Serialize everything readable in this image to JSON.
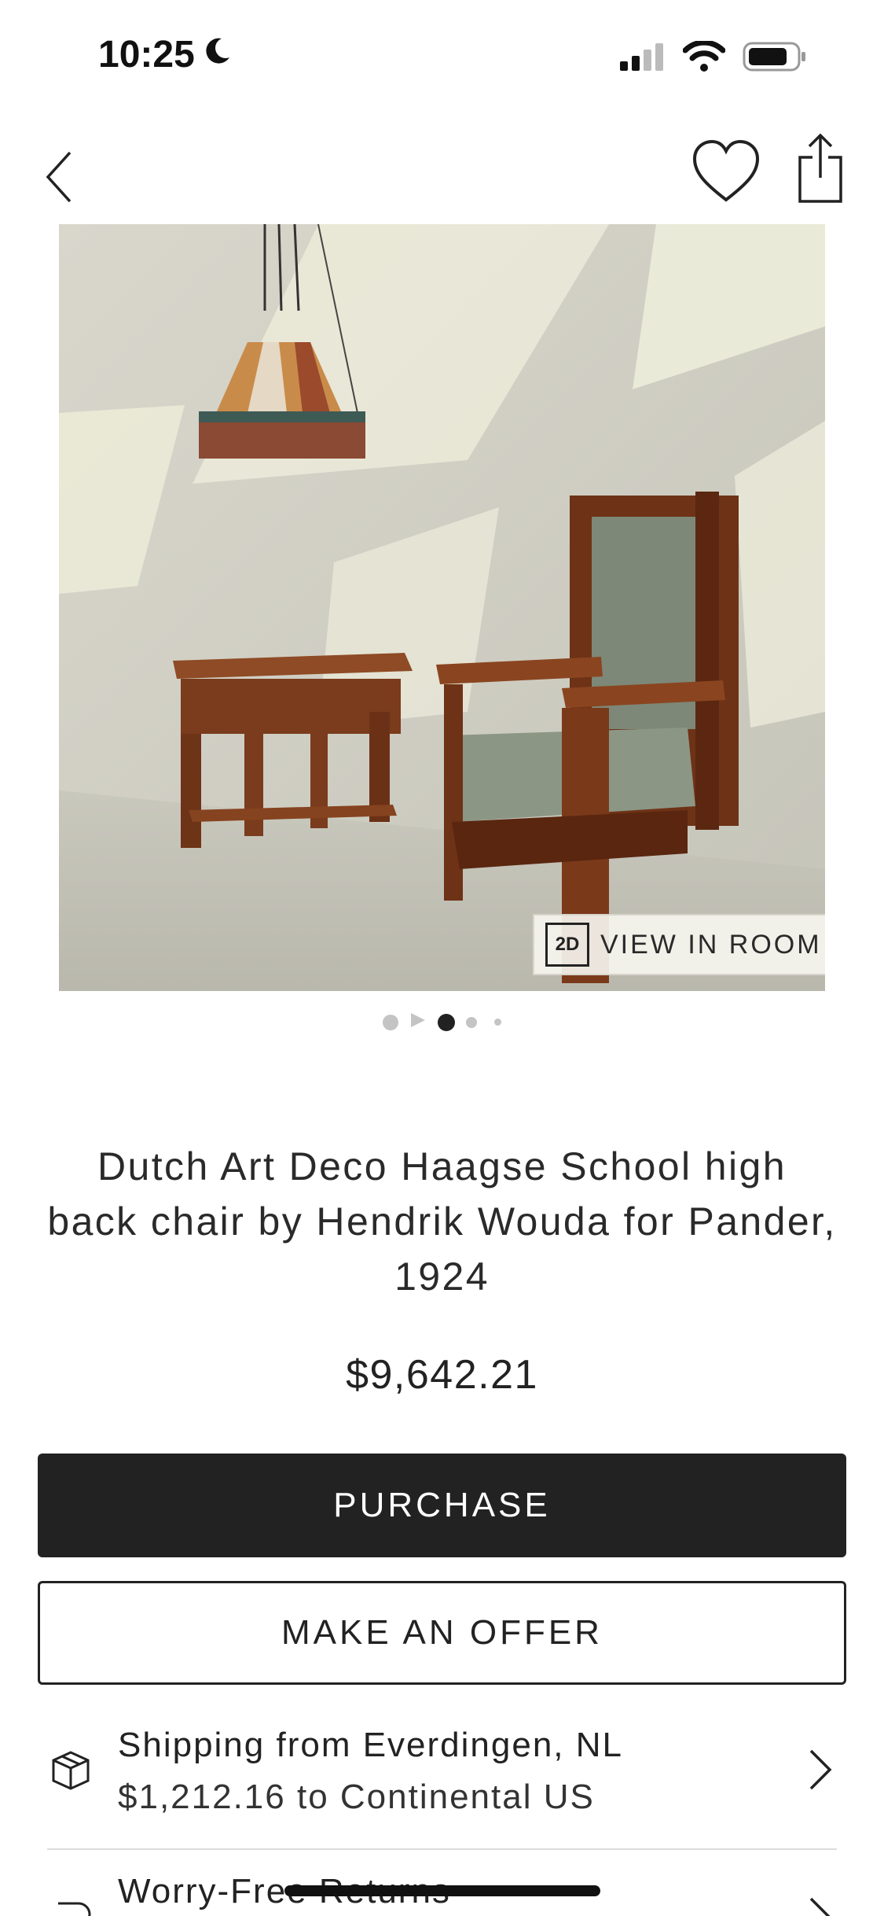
{
  "status_bar": {
    "time": "10:25",
    "icons": [
      "moon-icon",
      "signal-icon",
      "wifi-icon",
      "battery-icon"
    ]
  },
  "nav": {
    "icons": [
      "chevron-left-icon",
      "heart-icon",
      "share-icon"
    ]
  },
  "hero": {
    "view_in_room_badge": "2D",
    "view_in_room_label": "VIEW IN ROOM",
    "pager": {
      "count": 5,
      "active_index": 2
    }
  },
  "product": {
    "title": "Dutch Art Deco Haagse School high back chair by Hendrik Wouda for Pander, 1924",
    "price": "$9,642.21"
  },
  "actions": {
    "purchase_label": "PURCHASE",
    "offer_label": "MAKE AN OFFER"
  },
  "shipping": {
    "line1": "Shipping from Everdingen, NL",
    "line2": "$1,212.16 to Continental US",
    "icon": "package-icon"
  },
  "returns": {
    "line1": "Worry-Free Returns",
    "icon": "return-icon"
  },
  "colors": {
    "primary": "#222222",
    "background": "#ffffff",
    "divider": "#dcdcdc"
  }
}
